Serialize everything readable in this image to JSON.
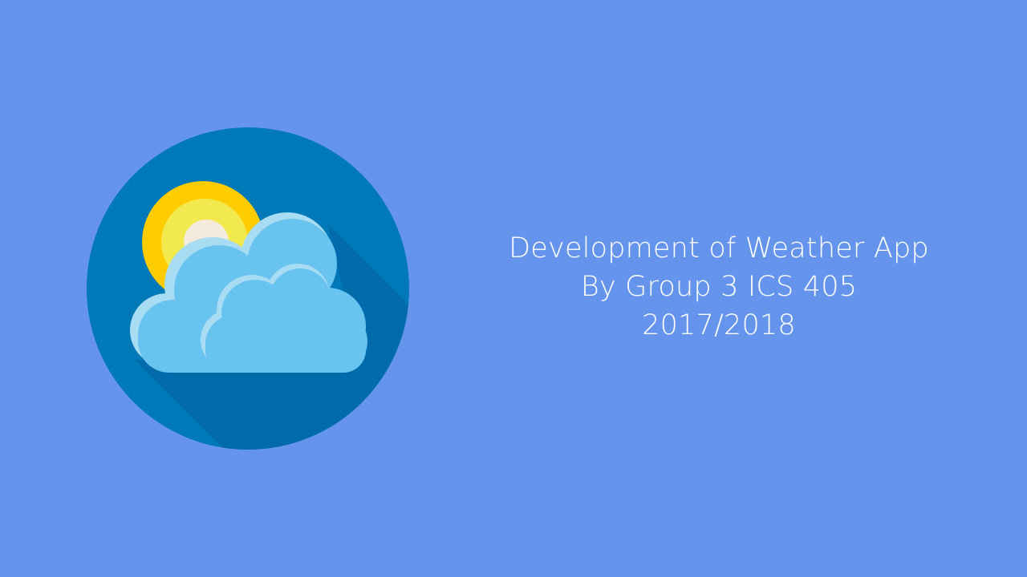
{
  "slide": {
    "background_color": "#6494EB",
    "logo": {
      "icon": "weather-partly-cloudy-icon",
      "circle_color": "#0079B8",
      "shadow_color": "#006BAA",
      "sun_outer_color": "#FFCC00",
      "sun_middle_color": "#F2E94E",
      "sun_inner_color": "#F5EBDC",
      "cloud_color": "#68C3EF",
      "cloud_highlight_color": "#A7DCF3"
    },
    "title_lines": [
      "Development of Weather App",
      "By Group 3 ICS 405",
      "2017/2018"
    ]
  }
}
